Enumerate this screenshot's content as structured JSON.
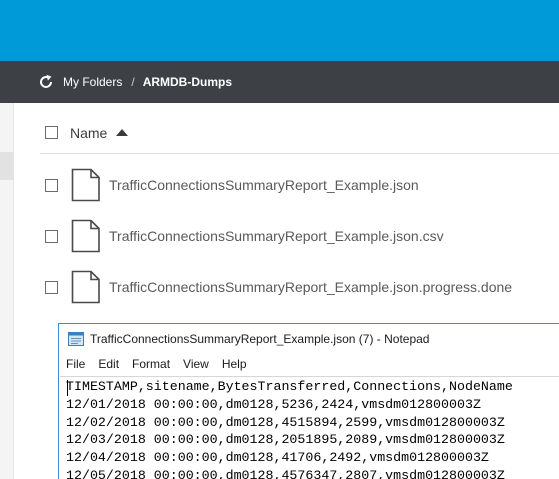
{
  "breadcrumb": {
    "refresh_icon": "refresh-icon",
    "items": [
      "My Folders",
      "ARMDB-Dumps"
    ],
    "separator": "/"
  },
  "file_list": {
    "header_label": "Name",
    "sort": "ascending",
    "files": [
      "TrafficConnectionsSummaryReport_Example.json",
      "TrafficConnectionsSummaryReport_Example.json.csv",
      "TrafficConnectionsSummaryReport_Example.json.progress.done"
    ]
  },
  "notepad": {
    "title": "TrafficConnectionsSummaryReport_Example.json (7) - Notepad",
    "menu": [
      "File",
      "Edit",
      "Format",
      "View",
      "Help"
    ],
    "lines": [
      "TIMESTAMP,sitename,BytesTransferred,Connections,NodeName",
      "12/01/2018 00:00:00,dm0128,5236,2424,vmsdm012800003Z",
      "12/02/2018 00:00:00,dm0128,4515894,2599,vmsdm012800003Z",
      "12/03/2018 00:00:00,dm0128,2051895,2089,vmsdm012800003Z",
      "12/04/2018 00:00:00,dm0128,41706,2492,vmsdm012800003Z",
      "12/05/2018 00:00:00,dm0128,4576347,2807,vmsdm012800003Z"
    ]
  },
  "colors": {
    "top_bar": "#009ad9",
    "breadcrumb_bar": "#3d4146",
    "window_border": "#3c8fd6"
  }
}
